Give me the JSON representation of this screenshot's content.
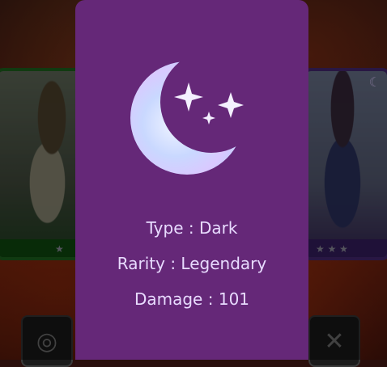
{
  "card": {
    "type_label": "Type",
    "type_value": "Dark",
    "rarity_label": "Rarity",
    "rarity_value": "Legendary",
    "damage_label": "Damage",
    "damage_value": "101",
    "separator": ":",
    "icon": "crescent-moon-stars-icon"
  },
  "colors": {
    "panel": "#652878",
    "text": "#e8dbff",
    "moon": "#cfe0ff"
  },
  "background_cards": {
    "left": {
      "rarity_stars": "★",
      "border_color": "#1f6b1f"
    },
    "right": {
      "rarity_stars": "★ ★ ★",
      "border_color": "#4b2a7a"
    }
  }
}
